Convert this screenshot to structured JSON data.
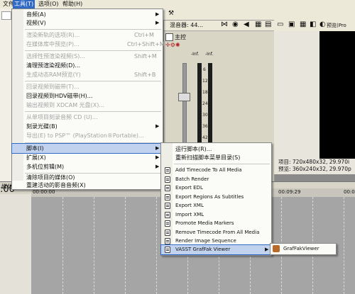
{
  "menubar": {
    "items": [
      "文件(F)",
      "工具(T)",
      "选项(O)",
      "帮助(H)"
    ],
    "active_index": 1
  },
  "mixer": {
    "title": "混音器: 44...",
    "master_label": "主控",
    "db_left": "-Inf.",
    "db_right": "-Inf.",
    "ticks": [
      "6",
      "12",
      "18",
      "24",
      "30",
      "36",
      "42",
      "48",
      "54"
    ]
  },
  "preview": {
    "label": "预览(Pro",
    "project_info": "项目: 720x480x32, 29.970i",
    "preview_info": "预览: 360x240x32, 29.970p"
  },
  "timeline": {
    "left_label": "媒体",
    "time_display": ":00",
    "ruler_ticks": [
      "00:00:00",
      "00:09:29",
      "00:0"
    ]
  },
  "tools_menu": {
    "items": [
      {
        "label": "音频(A)",
        "shortcut": "",
        "submenu": true,
        "disabled": false
      },
      {
        "label": "视频(V)",
        "shortcut": "",
        "submenu": true,
        "disabled": false
      },
      {
        "label": "渲染新轨的选项(R)...",
        "shortcut": "Ctrl+M",
        "disabled": true
      },
      {
        "label": "在媒体库中预览(P)...",
        "shortcut": "Ctrl+Shift+M",
        "disabled": true
      },
      {
        "label": "选择性预渲染视频(S)...",
        "shortcut": "Shift+M",
        "disabled": true
      },
      {
        "label": "清理预渲染视频(D)...",
        "shortcut": "",
        "disabled": false
      },
      {
        "label": "生成动态RAM预览(Y)",
        "shortcut": "Shift+B",
        "disabled": true
      },
      {
        "label": "回录视频到磁带(T)...",
        "shortcut": "",
        "disabled": true
      },
      {
        "label": "回录视频到HDV磁带(H)...",
        "shortcut": "",
        "disabled": false
      },
      {
        "label": "输出视频到 XDCAM 光盘(X)...",
        "shortcut": "",
        "disabled": true
      },
      {
        "label": "从单项目刻录音频 CD (U)...",
        "shortcut": "",
        "disabled": true
      },
      {
        "label": "刻录光碟(B)",
        "shortcut": "",
        "submenu": true,
        "disabled": false
      },
      {
        "label": "导出(E) to PSP™ (PlayStation®Portable)...",
        "shortcut": "",
        "disabled": true
      },
      {
        "label": "脚本(I)",
        "shortcut": "",
        "submenu": true,
        "disabled": false
      },
      {
        "label": "扩展(X)",
        "shortcut": "",
        "submenu": true,
        "disabled": false
      },
      {
        "label": "多机位剪辑(M)",
        "shortcut": "",
        "submenu": true,
        "disabled": false
      },
      {
        "label": "清除项目的媒体(O)",
        "shortcut": "",
        "disabled": false
      },
      {
        "label": "重建活动的影音音频(X)",
        "shortcut": "",
        "disabled": false
      }
    ]
  },
  "script_menu": {
    "items": [
      {
        "label": "运行脚本(R)...",
        "icon": "none"
      },
      {
        "label": "重新扫描脚本菜单目录(S)",
        "icon": "none"
      },
      {
        "label": "Add Timecode To All Media",
        "icon": "script-icon"
      },
      {
        "label": "Batch Render",
        "icon": "script-icon"
      },
      {
        "label": "Export EDL",
        "icon": "script-icon"
      },
      {
        "label": "Export Regions As Subtitles",
        "icon": "script-icon"
      },
      {
        "label": "Export XML",
        "icon": "script-icon"
      },
      {
        "label": "Import XML",
        "icon": "script-icon"
      },
      {
        "label": "Promote Media Markers",
        "icon": "script-icon"
      },
      {
        "label": "Remove Timecode From All Media",
        "icon": "script-icon"
      },
      {
        "label": "Render Image Sequence",
        "icon": "script-icon"
      },
      {
        "label": "VASST GrafFak Viewer",
        "icon": "script-icon",
        "submenu": true
      }
    ]
  },
  "graffak_menu": {
    "item": "GrafFakViewer",
    "icon": "graffak-app-icon"
  }
}
